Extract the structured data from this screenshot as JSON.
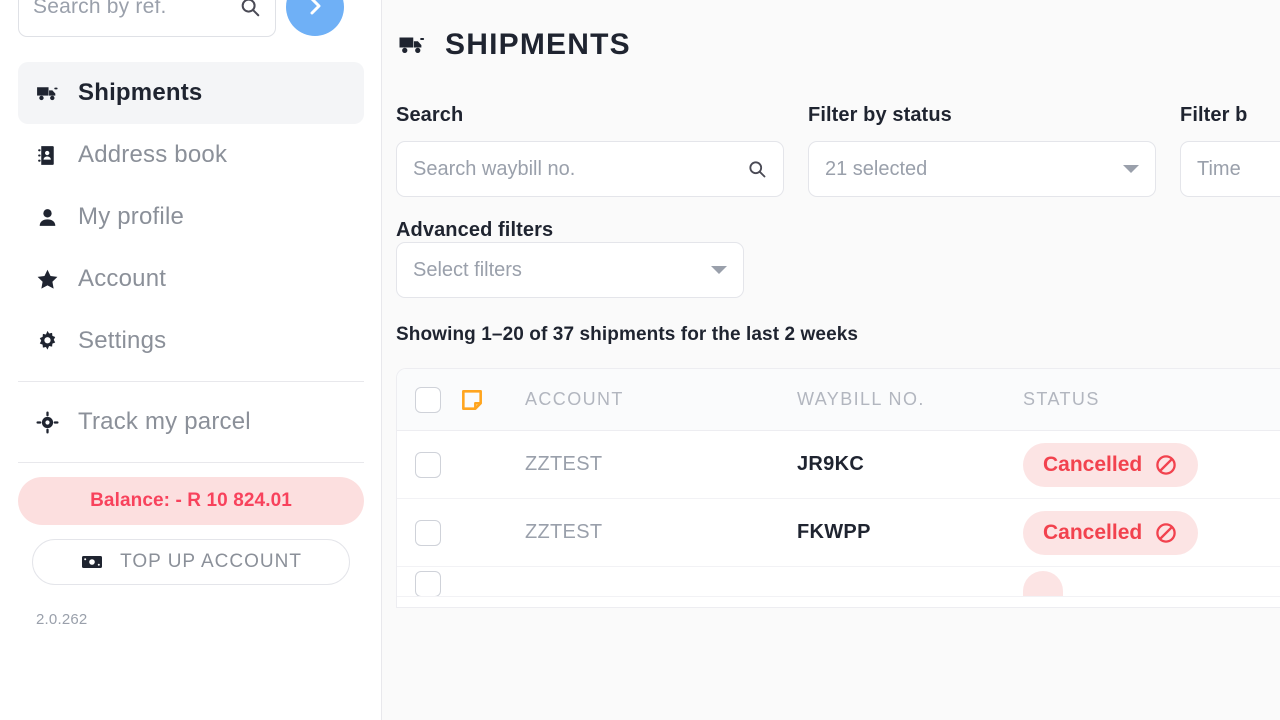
{
  "sidebar": {
    "ref_search": {
      "placeholder": "Search by ref.",
      "icon": "search-icon"
    },
    "next_button_icon": "chevron-right-icon",
    "nav": [
      {
        "label": "Shipments",
        "icon": "truck-icon",
        "active": true
      },
      {
        "label": "Address book",
        "icon": "address-book-icon",
        "active": false
      },
      {
        "label": "My profile",
        "icon": "person-icon",
        "active": false
      },
      {
        "label": "Account",
        "icon": "star-icon",
        "active": false
      },
      {
        "label": "Settings",
        "icon": "gear-icon",
        "active": false
      }
    ],
    "track": {
      "label": "Track my parcel",
      "icon": "target-icon"
    },
    "balance": {
      "label": "Balance: - R 10 824.01",
      "bg": "#fcdfdf",
      "color": "#f8425c"
    },
    "topup": {
      "label": "TOP UP ACCOUNT",
      "icon": "money-icon"
    },
    "version": "2.0.262"
  },
  "main": {
    "header": {
      "title": "SHIPMENTS",
      "icon": "truck-icon"
    },
    "filters": {
      "search": {
        "label": "Search",
        "placeholder": "Search waybill no.",
        "icon": "search-icon"
      },
      "status": {
        "label": "Filter by status",
        "value": "21 selected"
      },
      "time": {
        "label": "Filter b",
        "value": "Time"
      },
      "advanced": {
        "label": "Advanced filters",
        "value": "Select filters"
      }
    },
    "showing": "Showing 1–20 of 37 shipments for the last 2 weeks",
    "table": {
      "columns": [
        "ACCOUNT",
        "WAYBILL NO.",
        "STATUS"
      ],
      "header_note_icon": "note-icon",
      "rows": [
        {
          "account": "ZZTEST",
          "waybill": "JR9KC",
          "status": "Cancelled",
          "status_icon": "ban-icon"
        },
        {
          "account": "ZZTEST",
          "waybill": "FKWPP",
          "status": "Cancelled",
          "status_icon": "ban-icon"
        }
      ]
    }
  },
  "colors": {
    "accent_blue": "#6fb0f6",
    "danger_red": "#f2424e",
    "danger_bg": "#fce4e4",
    "note_orange": "#ffa51f",
    "muted": "#9aa0ab"
  }
}
